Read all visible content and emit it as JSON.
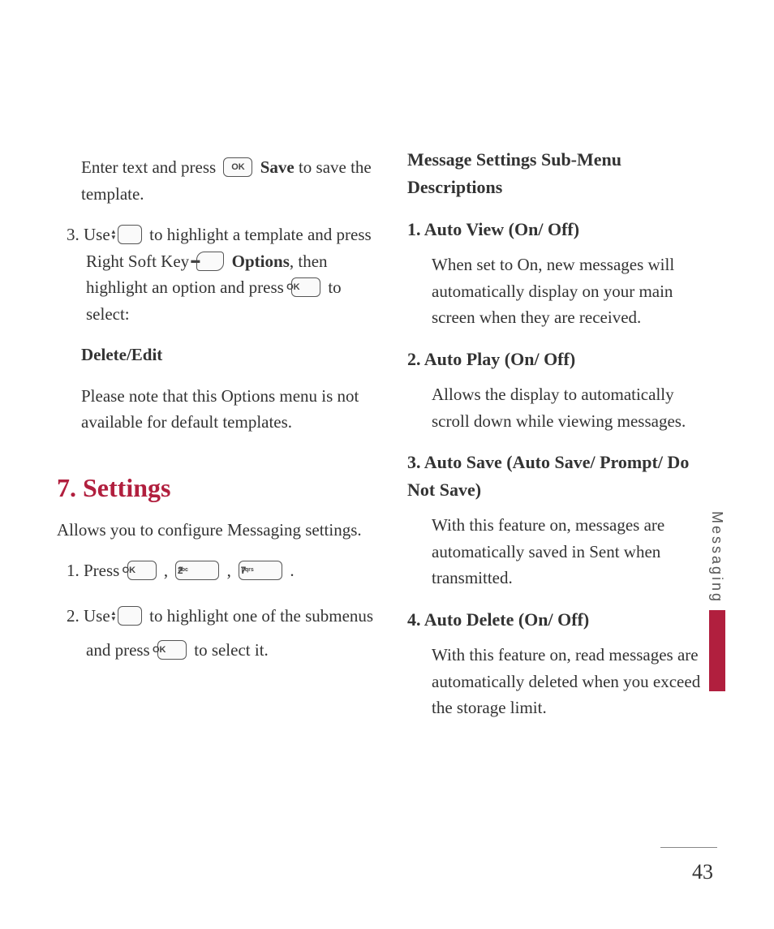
{
  "left": {
    "p1_a": "Enter text and press ",
    "p1_b": " Save",
    "p1_c": " to save the template.",
    "s3_num": "3. ",
    "s3_a": "Use ",
    "s3_b": " to highlight a template and press Right Soft Key ",
    "s3_c": " Options",
    "s3_d": ", then highlight an option and press ",
    "s3_e": " to select:",
    "delete_edit": "Delete/Edit",
    "note": "Please note that this Options menu is not available for default templates.",
    "title7": "7. Settings",
    "intro": "Allows you to configure Messaging settings.",
    "st1_num": "1. ",
    "st1_a": "Press ",
    "comma1": " , ",
    "comma2": " , ",
    "period": " .",
    "st2_num": "2. ",
    "st2_a": "Use ",
    "st2_b": " to highlight one of the submenus and press ",
    "st2_c": " to select it."
  },
  "right": {
    "heading": "Message Settings Sub-Menu Descriptions",
    "i1_t": "1. Auto View (On/ Off)",
    "i1_b": "When set to On, new messages will automatically display on your main screen when they are received.",
    "i2_t": "2. Auto Play (On/ Off)",
    "i2_b": "Allows the display to automatically scroll down while viewing messages.",
    "i3_t": "3. Auto Save (Auto Save/ Prompt/ Do Not Save)",
    "i3_b": "With this feature on, messages are automatically saved in Sent when transmitted.",
    "i4_t": "4. Auto Delete (On/ Off)",
    "i4_b": "With this feature on, read messages are automatically deleted when you exceed the storage limit."
  },
  "keys": {
    "ok": "OK",
    "softkey": "▬",
    "two": "2",
    "two_s": "abc",
    "seven": "7",
    "seven_s": "pqrs",
    "up": "▲",
    "down": "▼"
  },
  "tab": "Messaging",
  "page": "43"
}
